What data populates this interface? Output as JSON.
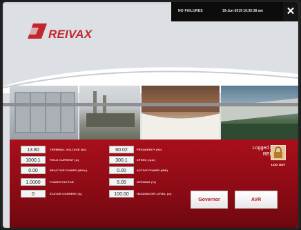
{
  "header": {
    "status": "NO FAILURES",
    "datetime": "19-Jun-2019 10:30:38 am",
    "close_label": "✕"
  },
  "brand": {
    "name": "REIVAX",
    "color": "#c1272d"
  },
  "measurements_left": [
    {
      "value": "13.80",
      "label": "TERMINAL VOLTAGE (kV)"
    },
    {
      "value": "1000.1",
      "label": "FIELD CURRENT (A)"
    },
    {
      "value": "0.00",
      "label": "REACTIVE POWER (MVAr)"
    },
    {
      "value": "1.0000",
      "label": "POWER FACTOR"
    },
    {
      "value": "0",
      "label": "STATOR CURRENT (A)"
    }
  ],
  "measurements_right": [
    {
      "value": "60.02",
      "label": "FREQUENCY (Hz)"
    },
    {
      "value": "300.1",
      "label": "SPEED (rpm)"
    },
    {
      "value": "0.00",
      "label": "ACTIVE POWER (MW)"
    },
    {
      "value": "5.05",
      "label": "OPENING (%)"
    },
    {
      "value": "100.00",
      "label": "HEADWATER LEVEL (m)"
    }
  ],
  "session": {
    "logged_line1": "Logged in as",
    "logged_line2": "REIVAX",
    "logout_label": "LOG OUT"
  },
  "buttons": {
    "governor": "Governor",
    "avr": "AVR"
  }
}
